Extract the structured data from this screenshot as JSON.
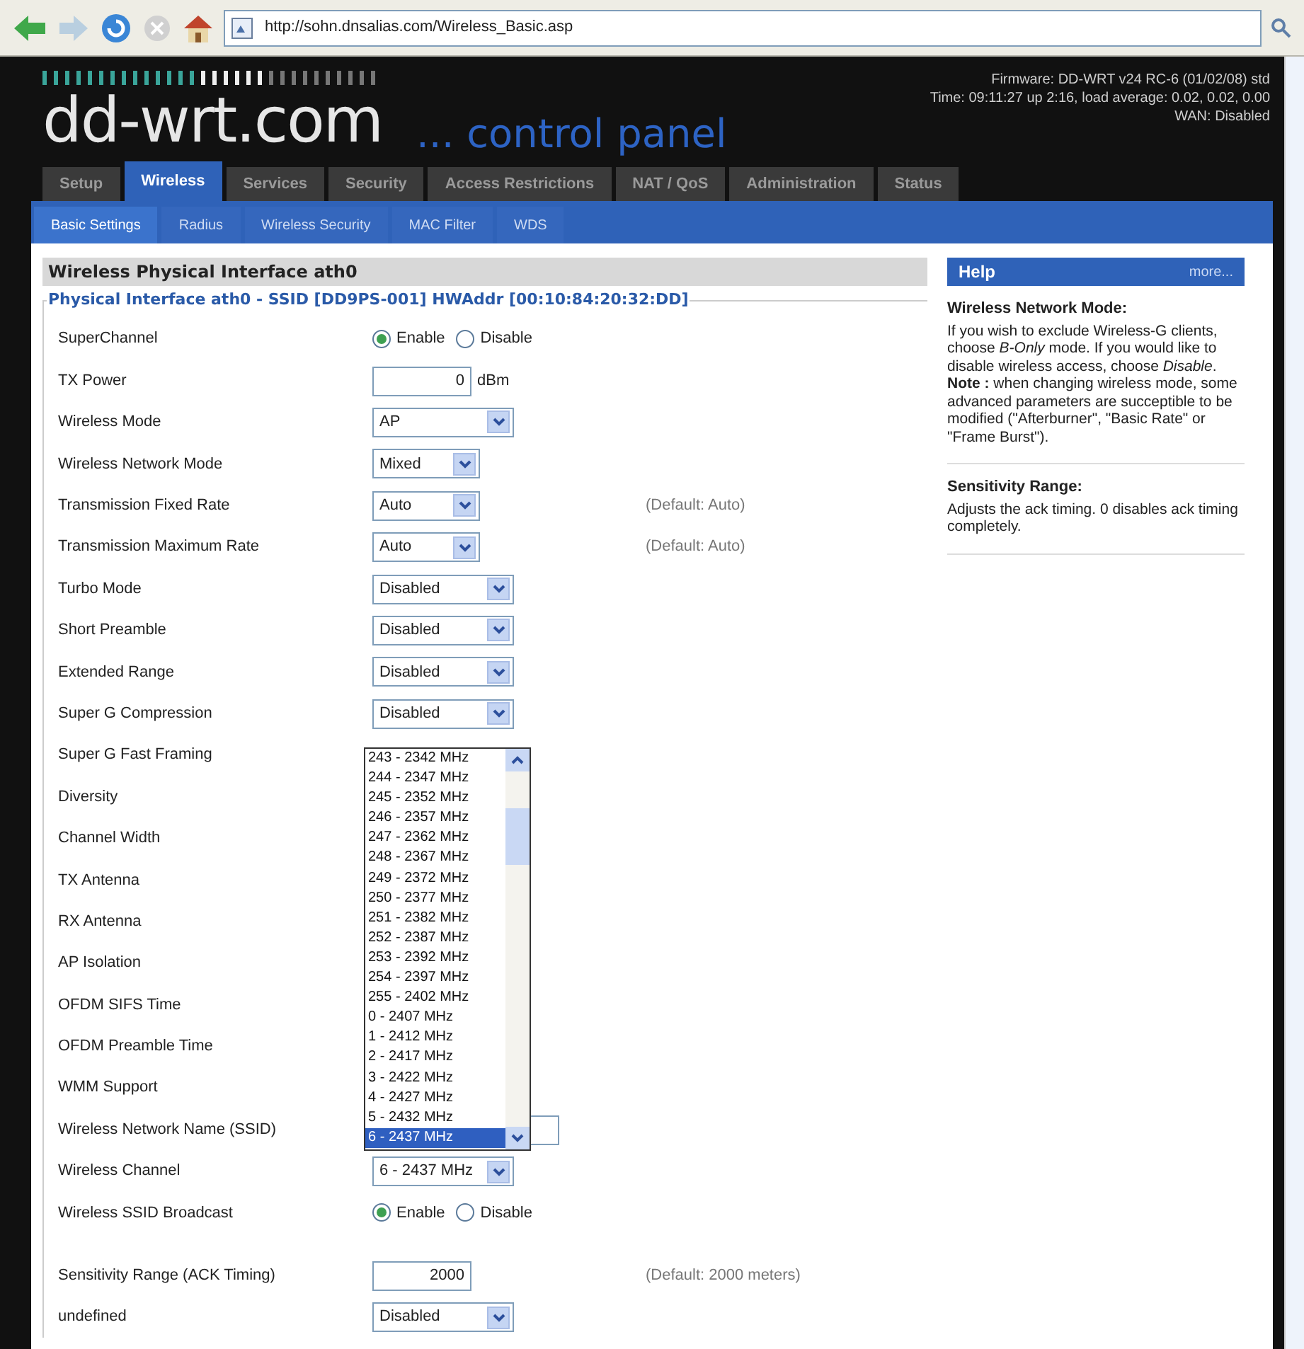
{
  "browser": {
    "url": "http://sohn.dnsalias.com/Wireless_Basic.asp"
  },
  "header": {
    "logo": "dd-wrt.com",
    "subtitle": "... control panel",
    "info": [
      "Firmware: DD-WRT v24 RC-6 (01/02/08) std",
      "Time: 09:11:27 up 2:16, load average: 0.02, 0.02, 0.00",
      "WAN: Disabled"
    ]
  },
  "tabs": [
    {
      "label": "Setup",
      "selected": false
    },
    {
      "label": "Wireless",
      "selected": true
    },
    {
      "label": "Services",
      "selected": false
    },
    {
      "label": "Security",
      "selected": false
    },
    {
      "label": "Access Restrictions",
      "selected": false
    },
    {
      "label": "NAT / QoS",
      "selected": false
    },
    {
      "label": "Administration",
      "selected": false
    },
    {
      "label": "Status",
      "selected": false
    }
  ],
  "subtabs": [
    {
      "label": "Basic Settings",
      "selected": true
    },
    {
      "label": "Radius",
      "selected": false
    },
    {
      "label": "Wireless Security",
      "selected": false
    },
    {
      "label": "MAC Filter",
      "selected": false
    },
    {
      "label": "WDS",
      "selected": false
    }
  ],
  "section": {
    "title": "Wireless Physical Interface ath0",
    "legend": "Physical Interface ath0 - SSID [DD9PS-001] HWAddr [00:10:84:20:32:DD]",
    "rows": [
      {
        "kind": "radio",
        "label": "SuperChannel",
        "options": [
          {
            "label": "Enable",
            "selected": true
          },
          {
            "label": "Disable",
            "selected": false
          }
        ]
      },
      {
        "kind": "input",
        "label": "TX Power",
        "value": "0",
        "unit": "dBm"
      },
      {
        "kind": "select",
        "label": "Wireless Mode",
        "value": "AP"
      },
      {
        "kind": "select",
        "label": "Wireless Network Mode",
        "value": "Mixed"
      },
      {
        "kind": "select",
        "label": "Transmission Fixed Rate",
        "value": "Auto",
        "note": "(Default: Auto)"
      },
      {
        "kind": "select",
        "label": "Transmission Maximum Rate",
        "value": "Auto",
        "note": "(Default: Auto)"
      },
      {
        "kind": "select",
        "label": "Turbo Mode",
        "value": "Disabled"
      },
      {
        "kind": "select",
        "label": "Short Preamble",
        "value": "Disabled"
      },
      {
        "kind": "select",
        "label": "Extended Range",
        "value": "Disabled"
      },
      {
        "kind": "select",
        "label": "Super G Compression",
        "value": "Disabled"
      },
      {
        "kind": "covered",
        "label": "Super G Fast Framing"
      },
      {
        "kind": "covered",
        "label": "Diversity"
      },
      {
        "kind": "covered",
        "label": "Channel Width"
      },
      {
        "kind": "covered",
        "label": "TX Antenna"
      },
      {
        "kind": "covered",
        "label": "RX Antenna"
      },
      {
        "kind": "covered",
        "label": "AP Isolation"
      },
      {
        "kind": "covered",
        "label": "OFDM SIFS Time"
      },
      {
        "kind": "covered",
        "label": "OFDM Preamble Time"
      },
      {
        "kind": "covered",
        "label": "WMM Support"
      },
      {
        "kind": "input",
        "label": "Wireless Network Name (SSID)"
      },
      {
        "kind": "select",
        "label": "Wireless Channel",
        "value": "6 - 2437 MHz"
      },
      {
        "kind": "radio",
        "label": "Wireless SSID Broadcast",
        "options": [
          {
            "label": "Enable",
            "selected": true
          },
          {
            "label": "Disable",
            "selected": false
          }
        ]
      },
      {
        "kind": "spacer"
      },
      {
        "kind": "input",
        "label": "Sensitivity Range (ACK Timing)",
        "value": "2000",
        "note": "(Default: 2000 meters)"
      },
      {
        "kind": "select",
        "label": "undefined",
        "value": "Disabled"
      }
    ],
    "dropdown": [
      {
        "label": "243 - 2342 MHz",
        "selected": false
      },
      {
        "label": "244 - 2347 MHz",
        "selected": false
      },
      {
        "label": "245 - 2352 MHz",
        "selected": false
      },
      {
        "label": "246 - 2357 MHz",
        "selected": false
      },
      {
        "label": "247 - 2362 MHz",
        "selected": false
      },
      {
        "label": "248 - 2367 MHz",
        "selected": false
      },
      {
        "label": "249 - 2372 MHz",
        "selected": false
      },
      {
        "label": "250 - 2377 MHz",
        "selected": false
      },
      {
        "label": "251 - 2382 MHz",
        "selected": false
      },
      {
        "label": "252 - 2387 MHz",
        "selected": false
      },
      {
        "label": "253 - 2392 MHz",
        "selected": false
      },
      {
        "label": "254 - 2397 MHz",
        "selected": false
      },
      {
        "label": "255 - 2402 MHz",
        "selected": false
      },
      {
        "label": "0 - 2407 MHz",
        "selected": false
      },
      {
        "label": "1 - 2412 MHz",
        "selected": false
      },
      {
        "label": "2 - 2417 MHz",
        "selected": false
      },
      {
        "label": "3 - 2422 MHz",
        "selected": false
      },
      {
        "label": "4 - 2427 MHz",
        "selected": false
      },
      {
        "label": "5 - 2432 MHz",
        "selected": false
      },
      {
        "label": "6 - 2437 MHz",
        "selected": true
      }
    ]
  },
  "help": {
    "title": "Help",
    "more": "more...",
    "topics": [
      {
        "title": "Wireless Network Mode:",
        "paragraphs": [
          "If you wish to exclude Wireless-G clients, choose *B-Only* mode. If you would like to disable wireless access, choose *Disable*.",
          "**Note :** when changing wireless mode, some advanced parameters are succeptible to be modified (\"Afterburner\", \"Basic Rate\" or \"Frame Burst\")."
        ]
      },
      {
        "title": "Sensitivity Range:",
        "paragraphs": [
          "Adjusts the ack timing. 0 disables ack timing completely."
        ]
      }
    ]
  }
}
